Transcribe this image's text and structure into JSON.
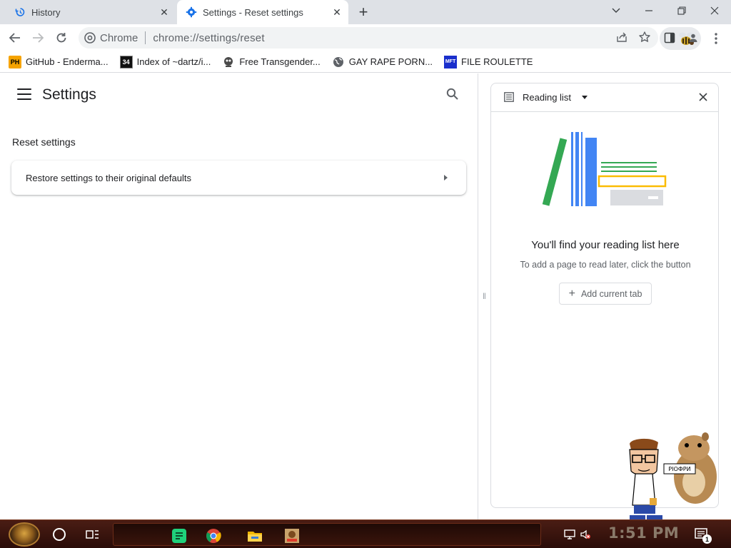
{
  "tabs": [
    {
      "title": "History",
      "icon": "history-icon"
    },
    {
      "title": "Settings - Reset settings",
      "icon": "gear-icon"
    }
  ],
  "toolbar": {
    "chip_label": "Chrome",
    "url": "chrome://settings/reset"
  },
  "bookmarks": [
    {
      "label": "GitHub - Enderma...",
      "icon": "ph-icon",
      "icon_text": "PH"
    },
    {
      "label": "Index of ~dartz/i...",
      "icon": "index-icon",
      "icon_text": "34"
    },
    {
      "label": "Free Transgender...",
      "icon": "bookmark-site-icon"
    },
    {
      "label": "GAY RAPE PORN...",
      "icon": "globe-icon"
    },
    {
      "label": "FILE ROULETTE",
      "icon": "mft-icon",
      "icon_text": "MFT"
    }
  ],
  "settings": {
    "title": "Settings",
    "section_title": "Reset settings",
    "restore_label": "Restore settings to their original defaults"
  },
  "reading_list": {
    "title": "Reading list",
    "empty_title": "You'll find your reading list here",
    "empty_sub": "To add a page to read later, click the button",
    "add_button": "Add current tab"
  },
  "desktop": {
    "hamster_sign": "РІОФРИ"
  },
  "taskbar": {
    "time": "1:51 PM",
    "notification_count": "1"
  },
  "colors": {
    "tabstrip": "#dee1e6",
    "accent_blue": "#1a73e8",
    "taskbar": "#3a140b"
  }
}
